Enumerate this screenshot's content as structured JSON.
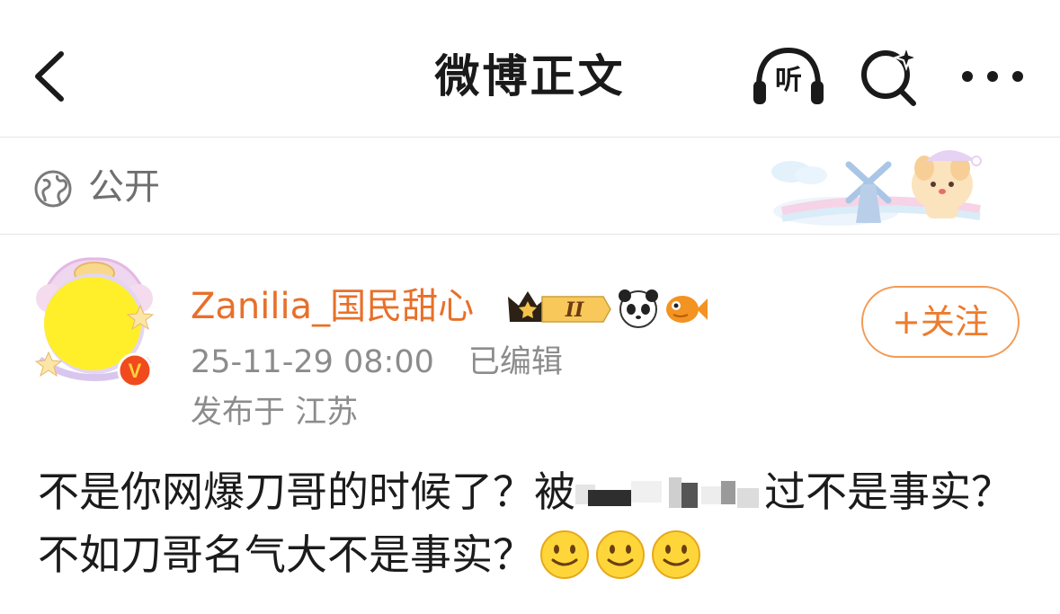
{
  "header": {
    "title": "微博正文",
    "listen_label": "听"
  },
  "visibility": {
    "label": "公开"
  },
  "post": {
    "author": "Zanilia_国民甜心",
    "level_badge": "II",
    "avatar_verify_mark": "V",
    "timestamp": "25-11-29 08:00",
    "edited_label": "已编辑",
    "location": "发布于 江苏",
    "follow_label": "+关注",
    "content_part1": "不是你网爆刀哥的时候了？被",
    "content_part2": "过不是事实？不如刀哥名气大不是事实？",
    "emojis": [
      "smile-emoji",
      "smile-emoji",
      "smile-emoji"
    ]
  },
  "colors": {
    "accent_orange": "#e8702a",
    "follow_border": "#f39a55",
    "muted_text": "#8c8c8c",
    "divider": "#e6e6e6"
  },
  "icons": [
    "back-arrow-icon",
    "listen-headphones-icon",
    "search-sparkle-icon",
    "more-dots-icon",
    "globe-icon"
  ]
}
